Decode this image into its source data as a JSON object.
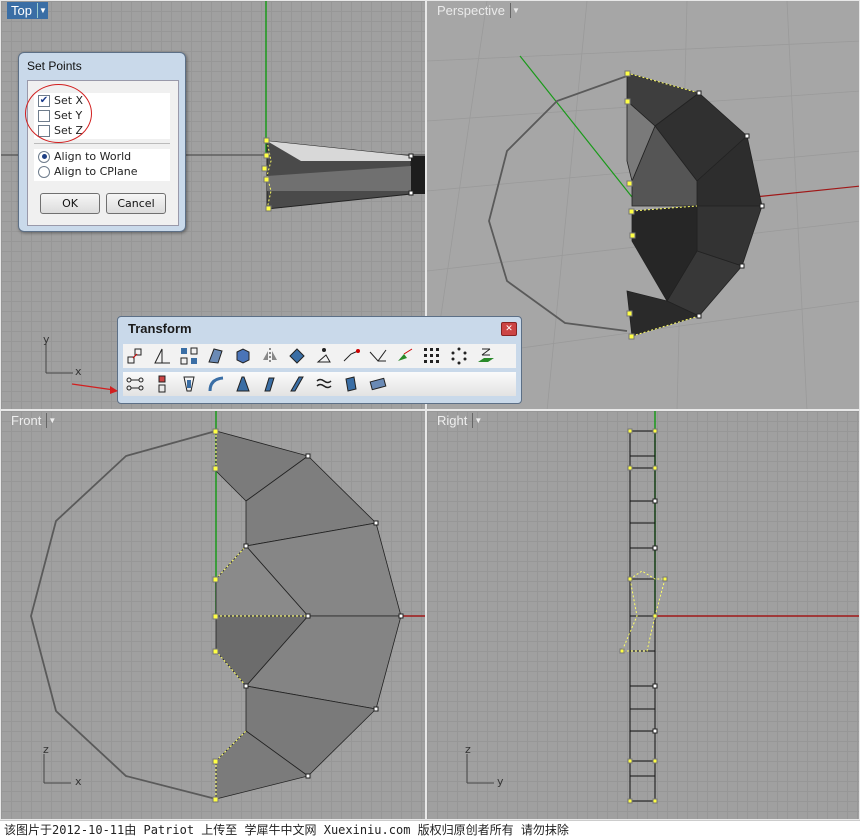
{
  "viewports": {
    "top": {
      "label": "Top"
    },
    "perspective": {
      "label": "Perspective"
    },
    "front": {
      "label": "Front"
    },
    "right": {
      "label": "Right"
    }
  },
  "axes": {
    "top": {
      "v": "y",
      "h": "x"
    },
    "front": {
      "v": "z",
      "h": "x"
    },
    "right": {
      "v": "z",
      "h": "y"
    }
  },
  "set_points_dialog": {
    "title": "Set Points",
    "checkboxes": [
      {
        "label": "Set X",
        "checked": true
      },
      {
        "label": "Set Y",
        "checked": false
      },
      {
        "label": "Set Z",
        "checked": false
      }
    ],
    "radios": [
      {
        "label": "Align to World",
        "selected": true
      },
      {
        "label": "Align to CPlane",
        "selected": false
      }
    ],
    "ok_label": "OK",
    "cancel_label": "Cancel"
  },
  "transform_toolbar": {
    "title": "Transform",
    "row1_icons": [
      "scale-icon",
      "scale-1d-icon",
      "array-icon",
      "shear-icon",
      "box-edit-icon",
      "mirror-icon",
      "rotate-icon",
      "set-points-icon",
      "orient-icon",
      "flow-icon",
      "twist-icon",
      "grid-array-icon",
      "polar-array-icon",
      "project-icon"
    ],
    "row2_icons": [
      "set-pt-icon",
      "align-icon",
      "taper-icon",
      "bend-icon",
      "stretch-icon",
      "smash-icon",
      "flow-along-icon",
      "splop-icon",
      "cage-icon",
      "cage-edit-icon"
    ]
  },
  "colors": {
    "accent": "#3a6ea5",
    "highlight": "#d21f1f",
    "point": "#ffff44"
  },
  "footer": {
    "text": "该图片于2012-10-11由 Patriot 上传至 学犀牛中文网 Xuexiniu.com 版权归原创者所有 请勿抹除"
  }
}
